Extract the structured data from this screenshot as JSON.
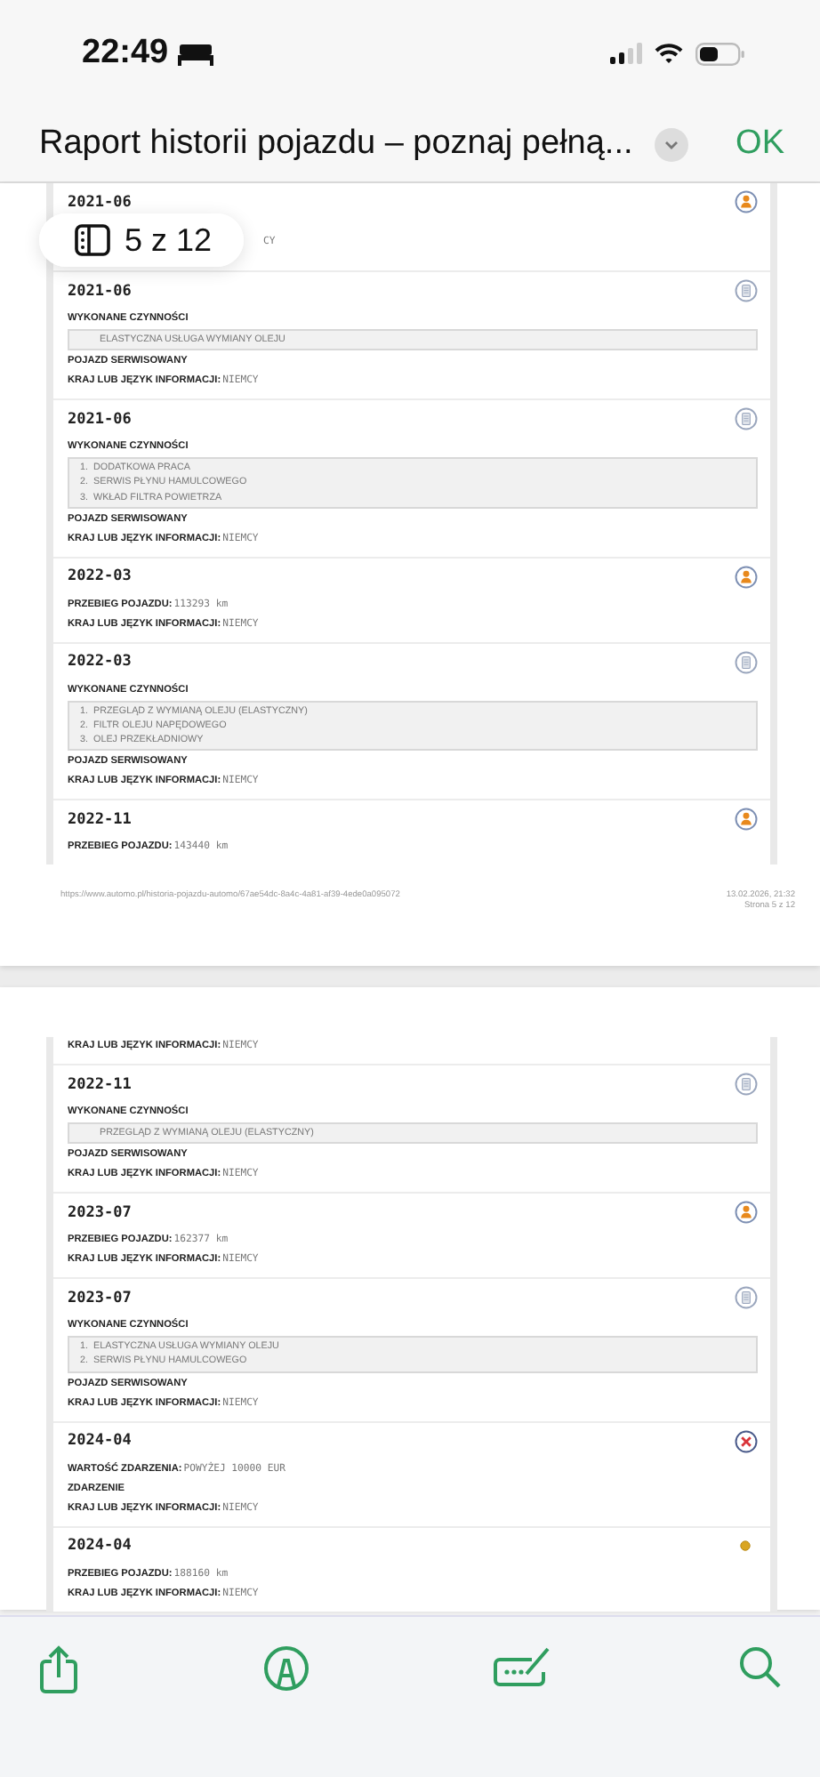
{
  "status_bar": {
    "time": "22:49"
  },
  "nav": {
    "title": "Raport historii pojazdu – poznaj pełną...",
    "done": "OK"
  },
  "page_badge": {
    "text": "5 z 12"
  },
  "pages": [
    {
      "entries": [
        {
          "date": "2021-06",
          "kind": "person",
          "lines": [
            {
              "kind": "fragment",
              "text": "CY"
            }
          ]
        },
        {
          "date": "2021-06",
          "kind": "document",
          "lines": [
            {
              "kind": "heading",
              "text": "WYKONANE CZYNNOŚCI"
            },
            {
              "kind": "list",
              "items": [
                {
                  "text": "ELASTYCZNA USŁUGA WYMIANY OLEJU"
                }
              ]
            },
            {
              "kind": "heading",
              "text": "POJAZD SERWISOWANY"
            },
            {
              "kind": "field",
              "label": "KRAJ LUB JĘZYK INFORMACJI:",
              "value": "NIEMCY"
            }
          ]
        },
        {
          "date": "2021-06",
          "kind": "document",
          "lines": [
            {
              "kind": "heading",
              "text": "WYKONANE CZYNNOŚCI"
            },
            {
              "kind": "list",
              "items": [
                {
                  "number": "1.",
                  "text": "DODATKOWA PRACA"
                },
                {
                  "number": "2.",
                  "text": "SERWIS PŁYNU HAMULCOWEGO"
                },
                {
                  "number": "3.",
                  "text": "WKŁAD FILTRA POWIETRZA"
                }
              ]
            },
            {
              "kind": "heading",
              "text": "POJAZD SERWISOWANY"
            },
            {
              "kind": "field",
              "label": "KRAJ LUB JĘZYK INFORMACJI:",
              "value": "NIEMCY"
            }
          ]
        },
        {
          "date": "2022-03",
          "kind": "person",
          "lines": [
            {
              "kind": "field",
              "label": "PRZEBIEG POJAZDU:",
              "value": "113293  km"
            },
            {
              "kind": "field",
              "label": "KRAJ LUB JĘZYK INFORMACJI:",
              "value": "NIEMCY"
            }
          ]
        },
        {
          "date": "2022-03",
          "kind": "document",
          "lines": [
            {
              "kind": "heading",
              "text": "WYKONANE CZYNNOŚCI"
            },
            {
              "kind": "list",
              "items": [
                {
                  "number": "1.",
                  "text": "PRZEGLĄD Z WYMIANĄ OLEJU (ELASTYCZNY)"
                },
                {
                  "number": "2.",
                  "text": "FILTR OLEJU NAPĘDOWEGO"
                },
                {
                  "number": "3.",
                  "text": "OLEJ PRZEKŁADNIOWY"
                }
              ]
            },
            {
              "kind": "heading",
              "text": "POJAZD SERWISOWANY"
            },
            {
              "kind": "field",
              "label": "KRAJ LUB JĘZYK INFORMACJI:",
              "value": "NIEMCY"
            }
          ]
        },
        {
          "date": "2022-11",
          "kind": "person",
          "lines": [
            {
              "kind": "field",
              "label": "PRZEBIEG POJAZDU:",
              "value": "143440  km"
            }
          ]
        }
      ],
      "footer": {
        "url": "https://www.automo.pl/historia-pojazdu-automo/67ae54dc-8a4c-4a81-af39-4ede0a095072",
        "date": "13.02.2026, 21:32",
        "page": "Strona 5 z 12"
      }
    },
    {
      "entries": [
        {
          "lines": [
            {
              "kind": "field",
              "label": "KRAJ LUB JĘZYK INFORMACJI:",
              "value": "NIEMCY"
            }
          ]
        },
        {
          "date": "2022-11",
          "kind": "document",
          "lines": [
            {
              "kind": "heading",
              "text": "WYKONANE CZYNNOŚCI"
            },
            {
              "kind": "list",
              "items": [
                {
                  "text": "PRZEGLĄD Z WYMIANĄ OLEJU (ELASTYCZNY)"
                }
              ]
            },
            {
              "kind": "heading",
              "text": "POJAZD SERWISOWANY"
            },
            {
              "kind": "field",
              "label": "KRAJ LUB JĘZYK INFORMACJI:",
              "value": "NIEMCY"
            }
          ]
        },
        {
          "date": "2023-07",
          "kind": "person",
          "lines": [
            {
              "kind": "field",
              "label": "PRZEBIEG POJAZDU:",
              "value": "162377  km"
            },
            {
              "kind": "field",
              "label": "KRAJ LUB JĘZYK INFORMACJI:",
              "value": "NIEMCY"
            }
          ]
        },
        {
          "date": "2023-07",
          "kind": "document",
          "lines": [
            {
              "kind": "heading",
              "text": "WYKONANE CZYNNOŚCI"
            },
            {
              "kind": "list",
              "items": [
                {
                  "number": "1.",
                  "text": "ELASTYCZNA USŁUGA WYMIANY OLEJU"
                },
                {
                  "number": "2.",
                  "text": "SERWIS PŁYNU HAMULCOWEGO"
                }
              ]
            },
            {
              "kind": "heading",
              "text": "POJAZD SERWISOWANY"
            },
            {
              "kind": "field",
              "label": "KRAJ LUB JĘZYK INFORMACJI:",
              "value": "NIEMCY"
            }
          ]
        },
        {
          "date": "2024-04",
          "kind": "damage",
          "lines": [
            {
              "kind": "field",
              "label": "WARTOŚĆ ZDARZENIA:",
              "value": "POWYŻEJ 10000 EUR"
            },
            {
              "kind": "heading",
              "text": "ZDARZENIE"
            },
            {
              "kind": "field",
              "label": "KRAJ LUB JĘZYK INFORMACJI:",
              "value": "NIEMCY"
            }
          ]
        },
        {
          "date": "2024-04",
          "kind": "dot",
          "lines": [
            {
              "kind": "field",
              "label": "PRZEBIEG POJAZDU:",
              "value": "188160  km"
            },
            {
              "kind": "field",
              "label": "KRAJ LUB JĘZYK INFORMACJI:",
              "value": "NIEMCY"
            }
          ]
        }
      ]
    }
  ]
}
